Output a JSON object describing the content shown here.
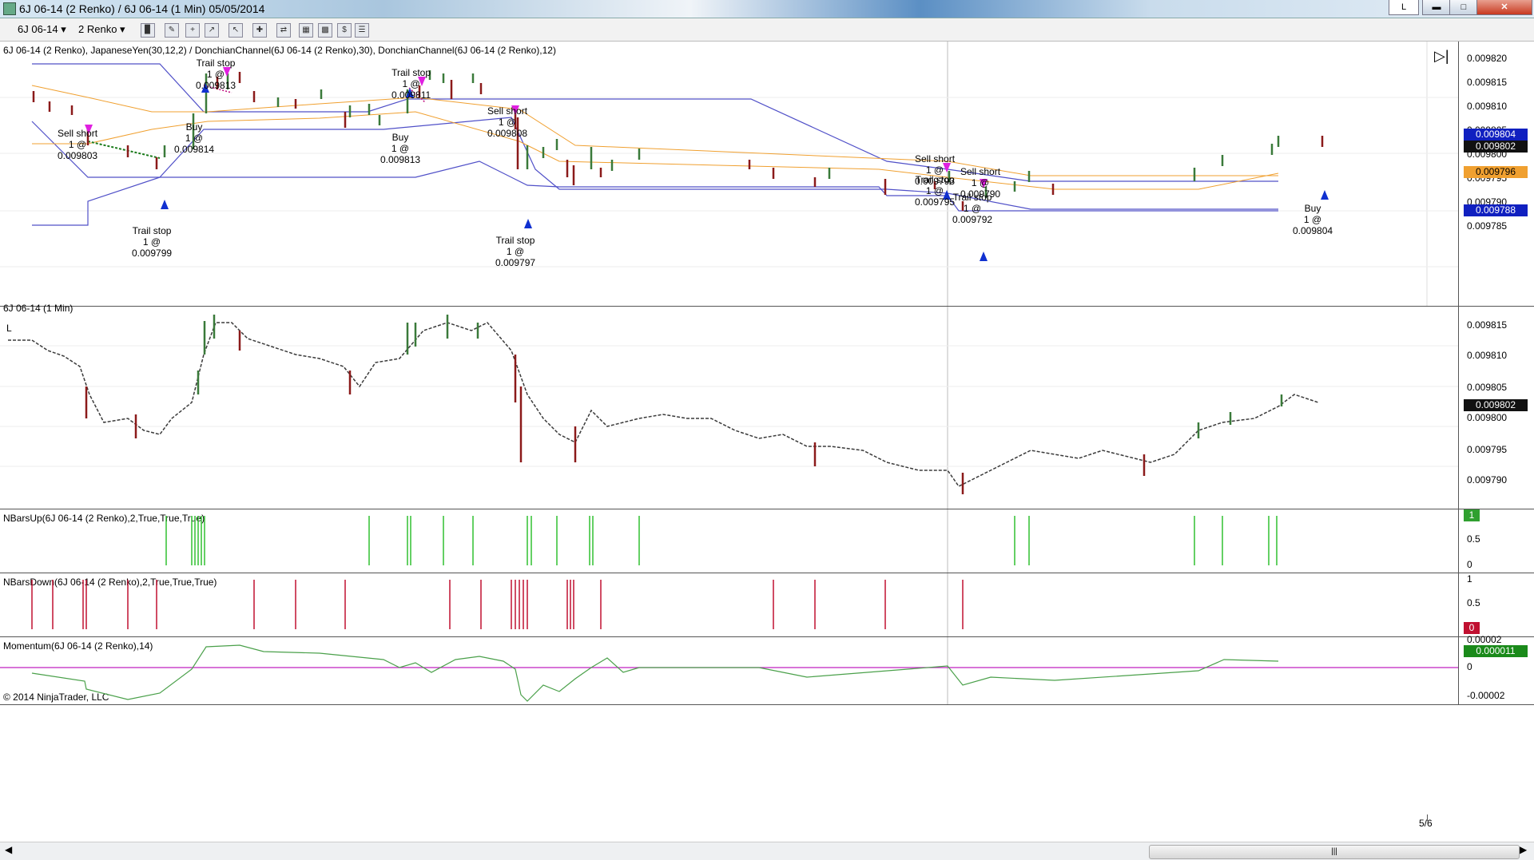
{
  "window": {
    "title": "6J 06-14 (2 Renko) / 6J 06-14 (1 Min)  05/05/2014",
    "btn_l": "L"
  },
  "toolbar": {
    "instrument": "6J 06-14",
    "period": "2 Renko"
  },
  "colors": {
    "up_bar": "#3a7a3a",
    "down_bar": "#8b1a1a",
    "donchian_30": "#5050c8",
    "donchian_12": "#f0a030",
    "buy_arrow": "#1030d0",
    "sell_arrow": "#e020e0",
    "nbars_up": "#30c030",
    "nbars_down": "#c01030",
    "momentum": "#4aa04a",
    "zero_line": "#c020c0"
  },
  "panel1": {
    "label": "6J 06-14 (2 Renko),  JapaneseYen(30,12,2)  /  DonchianChannel(6J  06-14  (2 Renko),30),  DonchianChannel(6J  06-14  (2 Renko),12)",
    "ticks": [
      "0.009820",
      "0.009815",
      "0.009810",
      "0.009805",
      "0.009800",
      "0.009795",
      "0.009790",
      "0.009785"
    ],
    "tag_1": "0.009804",
    "tag_2": "0.009802",
    "tag_3": "0.009796",
    "tag_4": "0.009788",
    "annotations": [
      {
        "line1": "Sell short",
        "line2": "1 @ 0.009803"
      },
      {
        "line1": "Trail stop",
        "line2": "1 @ 0.009799"
      },
      {
        "line1": "Trail stop",
        "line2": "1 @ 0.009813"
      },
      {
        "line1": "Buy",
        "line2": "1 @ 0.009814"
      },
      {
        "line1": "Trail stop",
        "line2": "1 @ 0.009811"
      },
      {
        "line1": "Buy",
        "line2": "1 @ 0.009813"
      },
      {
        "line1": "Sell short",
        "line2": "1 @ 0.009808"
      },
      {
        "line1": "Trail stop",
        "line2": "1 @ 0.009797"
      },
      {
        "line1": "Sell short",
        "line2": "1 @ 0.009793"
      },
      {
        "line1": "Trail stop",
        "line2": "1 @ 0.009795"
      },
      {
        "line1": "Sell short",
        "line2": "1 @ 0.009790"
      },
      {
        "line1": "Trail stop",
        "line2": "1 @ 0.009792"
      },
      {
        "line1": "Buy",
        "line2": "1 @ 0.009804"
      }
    ]
  },
  "panel2": {
    "label": "6J 06-14 (1 Min)",
    "marker": "L",
    "ticks": [
      "0.009815",
      "0.009810",
      "0.009805",
      "0.009800",
      "0.009795",
      "0.009790"
    ],
    "tag": "0.009802"
  },
  "panel3": {
    "label": "NBarsUp(6J  06-14  (2  Renko),2,True,True,True)",
    "ticks": [
      "0.5",
      "0"
    ],
    "tag": "1"
  },
  "panel4": {
    "label": "NBarsDown(6J  06-14  (2  Renko),2,True,True,True)",
    "ticks": [
      "1",
      "0.5"
    ],
    "tag": "0"
  },
  "panel5": {
    "label": "Momentum(6J 06-14 (2 Renko),14)",
    "ticks": [
      "0.00002",
      "0",
      "-0.00002"
    ],
    "tag": "0.000011",
    "copyright": "© 2014 NinjaTrader, LLC"
  },
  "time_axis": {
    "label": "5/6"
  }
}
